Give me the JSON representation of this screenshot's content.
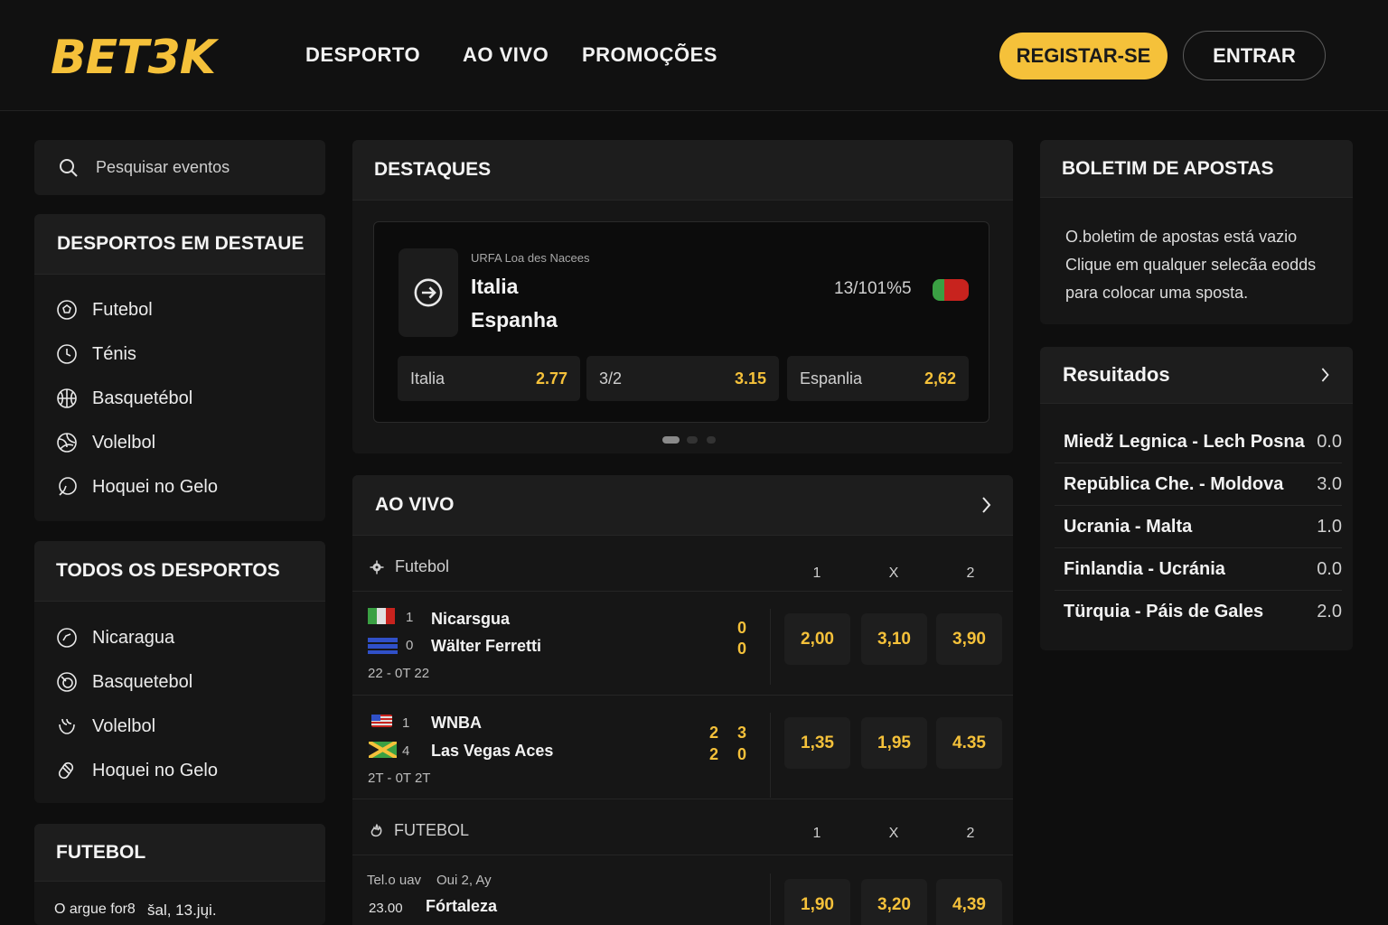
{
  "header": {
    "logo": "BET3K",
    "nav": [
      "DESPORTO",
      "AO VIVO",
      "PROMOÇÕES"
    ],
    "register_label": "REGISTAR-SE",
    "login_label": "ENTRAR"
  },
  "sidebar": {
    "search_placeholder": "Pesquisar eventos",
    "featured_title": "DESPORTOS EM DESTAUE",
    "featured_items": [
      {
        "label": "Futebol",
        "icon": "soccer-ball-icon"
      },
      {
        "label": "Ténis",
        "icon": "tennis-ball-icon"
      },
      {
        "label": "Basquetébol",
        "icon": "basketball-icon"
      },
      {
        "label": "Volelbol",
        "icon": "volleyball-icon"
      },
      {
        "label": "Hoquei no Gelo",
        "icon": "hockey-icon"
      }
    ],
    "all_title": "TODOS OS DESPORTOS",
    "all_items": [
      {
        "label": "Nicaragua",
        "icon": "compass-icon"
      },
      {
        "label": "Basquetebol",
        "icon": "basketball-icon"
      },
      {
        "label": "Volelbol",
        "icon": "volleyball-icon"
      },
      {
        "label": "Hoquei no Gelo",
        "icon": "hockey-icon"
      }
    ],
    "football_title": "FUTEBOL",
    "football_text_a": "O argue for8",
    "football_text_b": "šal, 13.jųi."
  },
  "highlights": {
    "title": "DESTAQUES",
    "competition": "URFA Loa des Nacees",
    "team1": "Italia",
    "team2": "Espanha",
    "datetime": "13/101%5",
    "odds": [
      {
        "label": "Italia",
        "value": "2.77"
      },
      {
        "label": "3/2",
        "value": "3.15"
      },
      {
        "label": "Espanlia",
        "value": "2,62"
      }
    ]
  },
  "live": {
    "title": "AO VIVO",
    "section1": {
      "sport": "Futebol",
      "cols": [
        "1",
        "X",
        "2"
      ],
      "matches": [
        {
          "team1_num": "1",
          "team1": "Nicarsgua",
          "team2_num": "0",
          "team2": "Wälter Ferretti",
          "score1": "0",
          "score2": "0",
          "time": "22 - 0T 22",
          "odds": [
            "2,00",
            "3,10",
            "3,90"
          ]
        },
        {
          "team1_num": "1",
          "team1": "WNBA",
          "team2_num": "4",
          "team2": "Las Vegas Aces",
          "score1a": "2",
          "score1b": "3",
          "score2a": "2",
          "score2b": "0",
          "time": "2T - 0T 2T",
          "odds": [
            "1,35",
            "1,95",
            "4.35"
          ]
        }
      ]
    },
    "section2": {
      "sport": "FUTEBOL",
      "cols": [
        "1",
        "X",
        "2"
      ],
      "match": {
        "meta_a": "Tel.o uav",
        "meta_b": "Oui 2, Ay",
        "time": "23.00",
        "team": "Fórtaleza",
        "odds": [
          "1,90",
          "3,20",
          "4,39"
        ]
      }
    }
  },
  "betslip": {
    "title": "BOLETIM DE APOSTAS",
    "line1": "O.boletim de apostas está vazio",
    "line2": "Clique em qualquer selecãa eodds",
    "line3": "para colocar uma sposta."
  },
  "results": {
    "title": "Resuitados",
    "rows": [
      {
        "match": "Miedž Legnica - Lech Posna",
        "score": "0.0"
      },
      {
        "match": "Repūblica Che. - Moldova",
        "score": "3.0"
      },
      {
        "match": "Ucrania - Malta",
        "score": "1.0"
      },
      {
        "match": "Finlandia - Ucránia",
        "score": "0.0"
      },
      {
        "match": "Türquia - Páis de Gales",
        "score": "2.0"
      }
    ]
  },
  "colors": {
    "accent": "#f5c13a",
    "background": "#0e0e0e",
    "panel": "#161616"
  }
}
